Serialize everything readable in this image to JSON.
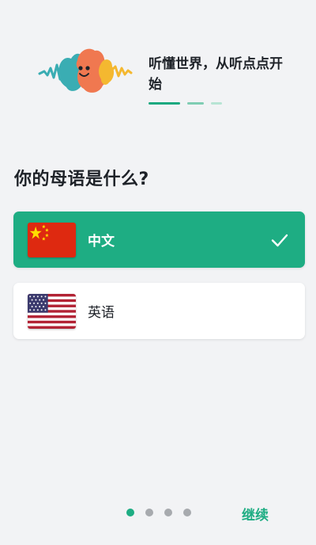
{
  "header": {
    "logo_icon": "sound-wave-mascot-icon",
    "tagline": "听懂世界，从听点点开始"
  },
  "onboarding": {
    "step_progress": "1 of 3"
  },
  "question": "你的母语是什么?",
  "languages": [
    {
      "label": "中文",
      "flag_icon": "china-flag-icon",
      "selected": true,
      "check_icon": "checkmark-icon"
    },
    {
      "label": "英语",
      "flag_icon": "us-flag-icon",
      "selected": false
    }
  ],
  "pager": {
    "total_pages": 4,
    "current_page": 1
  },
  "continue_label": "继续",
  "colors": {
    "accent": "#1ead83",
    "background": "#f2f3f5",
    "text": "#1e2228",
    "logo_teal": "#3aadb3",
    "logo_orange": "#f07850",
    "logo_yellow": "#f4b830"
  }
}
